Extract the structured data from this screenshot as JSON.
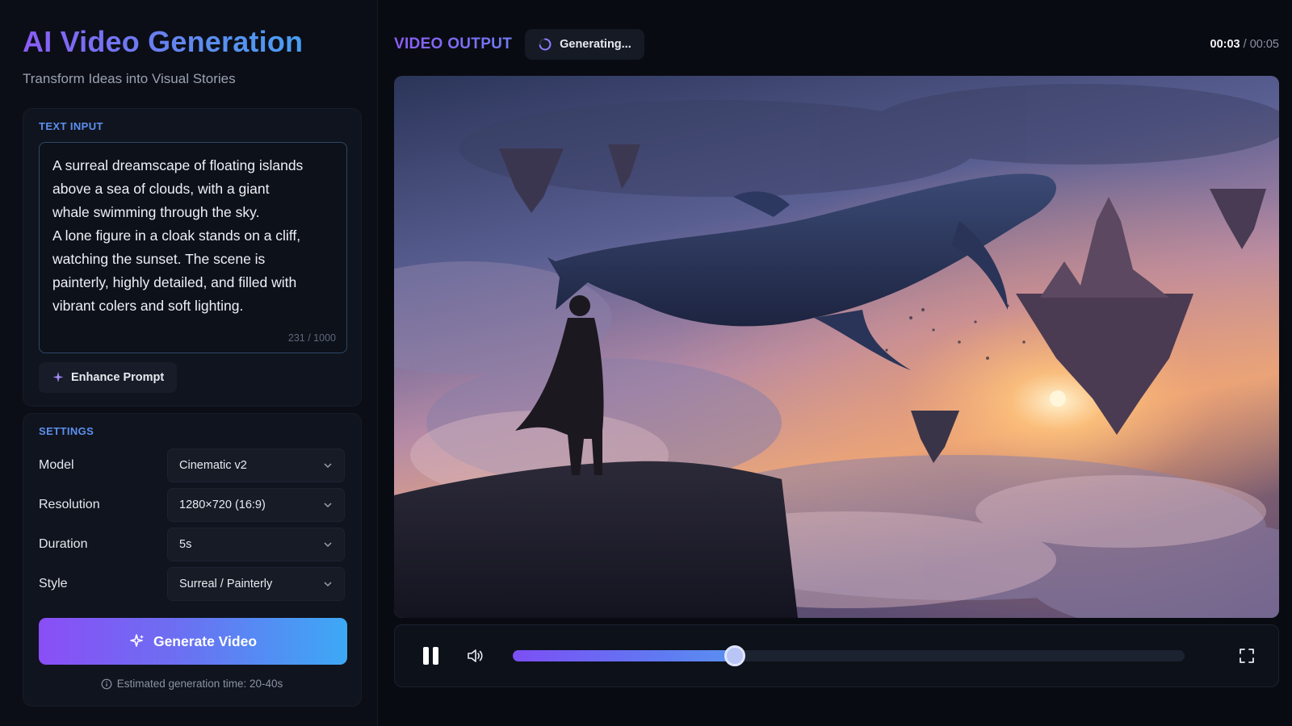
{
  "app": {
    "title": "AI Video Generation",
    "subtitle": "Transform Ideas into Visual Stories"
  },
  "text_input": {
    "label": "TEXT INPUT",
    "prompt": "A surreal dreamscape of floating islands\nabove a sea of clouds, with a giant\nwhale swimming through the sky.\nA lone figure in a cloak stands on a cliff,\nwatching the sunset. The scene is\npainterly, highly detailed, and filled with\nvibrant colers and soft lighting.",
    "char_count": "231 / 1000",
    "enhance_label": "Enhance Prompt",
    "enhance_icon": "sparkle-icon"
  },
  "settings": {
    "label": "SETTINGS",
    "rows": [
      {
        "label": "Model",
        "value": "Cinematic v2"
      },
      {
        "label": "Resolution",
        "value": "1280×720 (16:9)"
      },
      {
        "label": "Duration",
        "value": "5s"
      },
      {
        "label": "Style",
        "value": "Surreal / Painterly"
      }
    ],
    "generate_label": "Generate Video",
    "estimate": "Estimated generation time: 20-40s"
  },
  "output": {
    "title": "VIDEO OUTPUT",
    "status": "Generating...",
    "time_current": "00:03",
    "time_separator": " / ",
    "time_total": "00:05",
    "progress_fraction": 0.33
  },
  "colors": {
    "accent_purple": "#8b5cf6",
    "accent_blue": "#3ea8f5",
    "section_label": "#5d8ff0",
    "background": "#090b12"
  },
  "icons": {
    "pause": "pause-icon",
    "volume": "volume-icon",
    "fullscreen": "fullscreen-icon",
    "spinner": "spinner-icon",
    "info": "info-icon",
    "chevron": "chevron-down-icon"
  }
}
